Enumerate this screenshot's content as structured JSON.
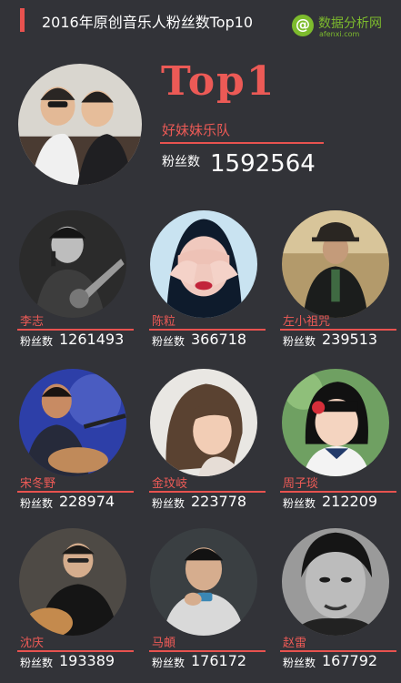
{
  "header": {
    "title": "2016年原创音乐人粉丝数Top10",
    "logo_text": "数据分析网",
    "logo_sub": "afenxi.com",
    "logo_mark": "@"
  },
  "top": {
    "rank": "Top1",
    "name": "好妹妹乐队",
    "fans_label": "粉丝数",
    "fans": "1592564"
  },
  "artists": [
    {
      "name": "李志",
      "fans_label": "粉丝数",
      "fans": "1261493"
    },
    {
      "name": "陈粒",
      "fans_label": "粉丝数",
      "fans": "366718"
    },
    {
      "name": "左小祖咒",
      "fans_label": "粉丝数",
      "fans": "239513"
    },
    {
      "name": "宋冬野",
      "fans_label": "粉丝数",
      "fans": "228974"
    },
    {
      "name": "金玟岐",
      "fans_label": "粉丝数",
      "fans": "223778"
    },
    {
      "name": "周子琰",
      "fans_label": "粉丝数",
      "fans": "212209"
    },
    {
      "name": "沈庆",
      "fans_label": "粉丝数",
      "fans": "193389"
    },
    {
      "name": "马頔",
      "fans_label": "粉丝数",
      "fans": "176172"
    },
    {
      "name": "赵雷",
      "fans_label": "粉丝数",
      "fans": "167792"
    }
  ],
  "colors": {
    "accent": "#e8524f",
    "background": "#323338",
    "logo": "#7dbb2d"
  }
}
